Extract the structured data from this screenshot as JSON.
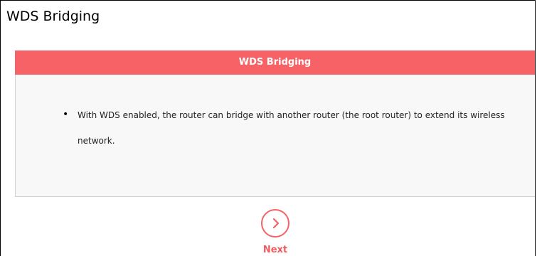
{
  "page": {
    "title": "WDS Bridging"
  },
  "panel": {
    "header": "WDS Bridging",
    "bullet_char": "•",
    "description": "With WDS enabled, the router can bridge with another router (the root router) to extend its wireless network."
  },
  "actions": {
    "next_label": "Next",
    "next_icon": "chevron-right-icon"
  },
  "colors": {
    "accent": "#f66266",
    "panel_bg": "#f8f8f8",
    "panel_border": "#d3d3d3"
  }
}
